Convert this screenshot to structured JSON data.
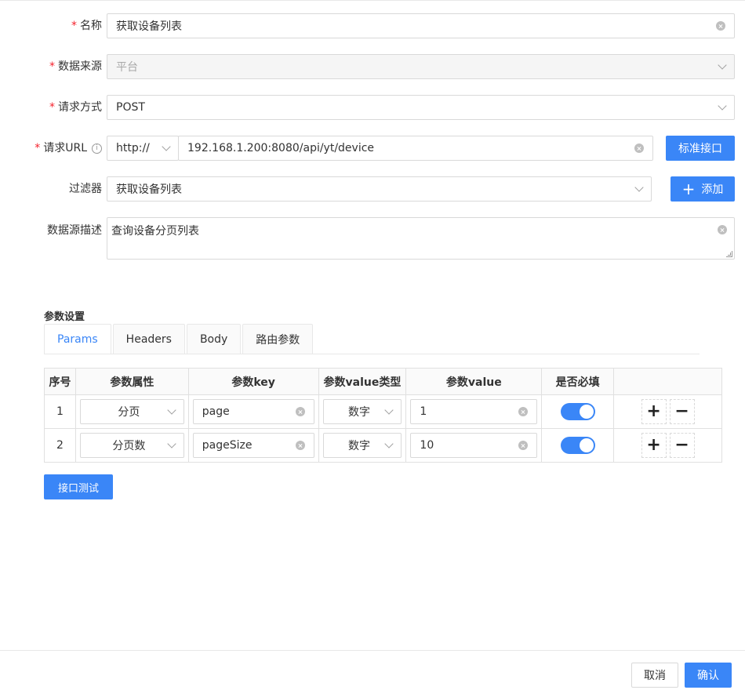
{
  "form": {
    "name": {
      "label": "名称",
      "value": "获取设备列表"
    },
    "source": {
      "label": "数据来源",
      "value": "平台"
    },
    "method": {
      "label": "请求方式",
      "value": "POST"
    },
    "url": {
      "label": "请求URL",
      "protocol": "http://",
      "value": "192.168.1.200:8080/api/yt/device",
      "button": "标准接口"
    },
    "filter": {
      "label": "过滤器",
      "value": "获取设备列表",
      "button": "添加"
    },
    "description": {
      "label": "数据源描述",
      "value": "查询设备分页列表"
    }
  },
  "params": {
    "title": "参数设置",
    "tabs": [
      "Params",
      "Headers",
      "Body",
      "路由参数"
    ],
    "active_tab": "Params",
    "columns": [
      "序号",
      "参数属性",
      "参数key",
      "参数value类型",
      "参数value",
      "是否必填",
      ""
    ],
    "rows": [
      {
        "index": "1",
        "attr": "分页",
        "key": "page",
        "type": "数字",
        "value": "1",
        "required": true
      },
      {
        "index": "2",
        "attr": "分页数",
        "key": "pageSize",
        "type": "数字",
        "value": "10",
        "required": true
      }
    ],
    "test_button": "接口测试"
  },
  "footer": {
    "cancel": "取消",
    "confirm": "确认"
  },
  "colors": {
    "primary": "#3a86f7",
    "required": "#f5222d"
  }
}
